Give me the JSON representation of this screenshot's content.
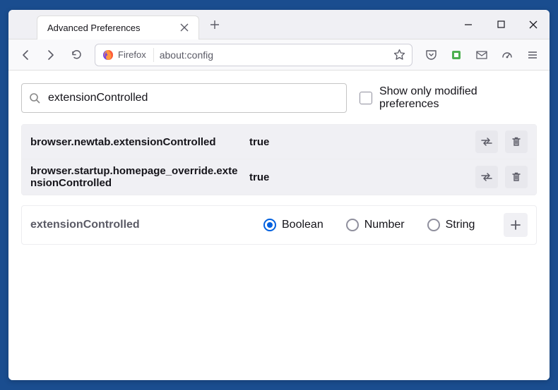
{
  "window": {
    "tab_title": "Advanced Preferences"
  },
  "toolbar": {
    "identity_label": "Firefox",
    "url_text": "about:config"
  },
  "search": {
    "value": "extensionControlled",
    "modified_only_label": "Show only modified preferences"
  },
  "prefs": [
    {
      "name": "browser.newtab.extensionControlled",
      "value": "true"
    },
    {
      "name": "browser.startup.homepage_override.extensionControlled",
      "value": "true"
    }
  ],
  "new_pref": {
    "name": "extensionControlled",
    "types": [
      "Boolean",
      "Number",
      "String"
    ],
    "selected": "Boolean"
  }
}
